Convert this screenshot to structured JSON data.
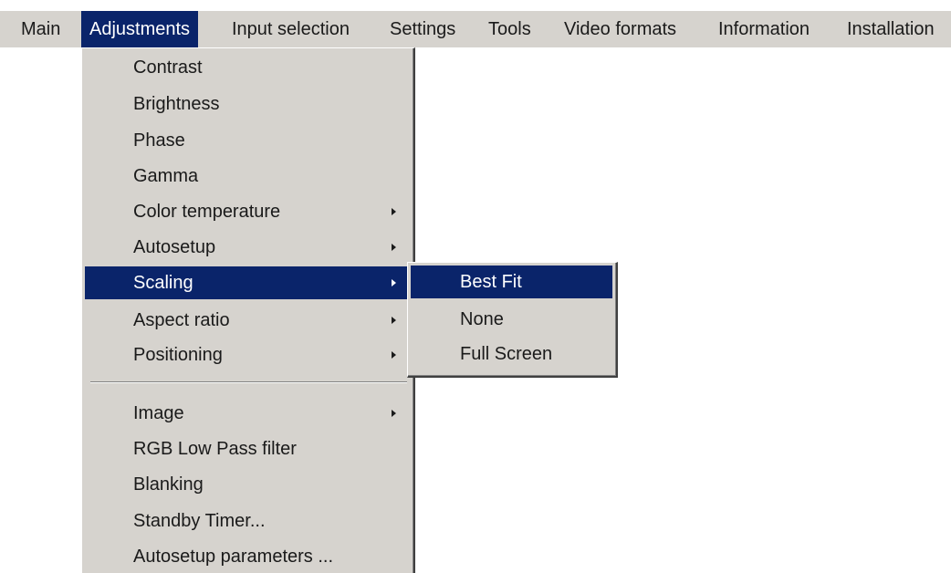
{
  "menubar": {
    "items": [
      {
        "label": "Main"
      },
      {
        "label": "Adjustments"
      },
      {
        "label": "Input selection"
      },
      {
        "label": "Settings"
      },
      {
        "label": "Tools"
      },
      {
        "label": "Video formats"
      },
      {
        "label": "Information"
      },
      {
        "label": "Installation"
      }
    ]
  },
  "adjustments_menu": {
    "items": [
      {
        "label": "Contrast"
      },
      {
        "label": "Brightness"
      },
      {
        "label": "Phase"
      },
      {
        "label": "Gamma"
      },
      {
        "label": "Color temperature",
        "submenu_icon": "arrow-right-icon"
      },
      {
        "label": "Autosetup",
        "submenu_icon": "arrow-right-icon"
      },
      {
        "label": "Scaling",
        "submenu_icon": "arrow-right-icon",
        "state": "highlighted"
      },
      {
        "label": "Aspect ratio",
        "submenu_icon": "arrow-right-icon"
      },
      {
        "label": "Positioning",
        "submenu_icon": "arrow-right-icon"
      },
      {
        "label": "Image",
        "submenu_icon": "arrow-right-icon"
      },
      {
        "label": "RGB Low Pass filter"
      },
      {
        "label": "Blanking"
      },
      {
        "label": "Standby Timer..."
      },
      {
        "label": "Autosetup parameters ..."
      }
    ]
  },
  "scaling_submenu": {
    "items": [
      {
        "label": "Best Fit",
        "state": "highlighted"
      },
      {
        "label": "None"
      },
      {
        "label": "Full Screen"
      }
    ]
  },
  "colors": {
    "menu_background": "#d6d3ce",
    "highlight": "#0a246a",
    "highlight_text": "#ffffff"
  }
}
